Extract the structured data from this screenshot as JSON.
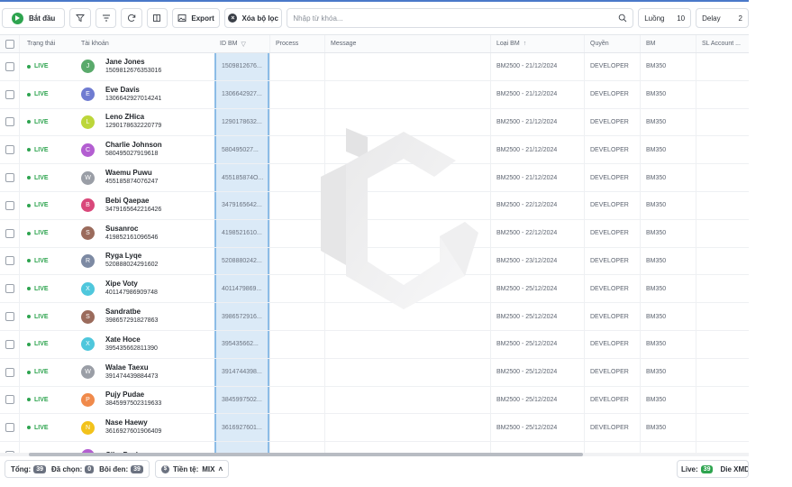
{
  "toolbar": {
    "start_label": "Bắt đầu",
    "export_label": "Export",
    "clear_filter_label": "Xóa bộ lọc",
    "search_placeholder": "Nhập từ khóa...",
    "threads_label": "Luồng",
    "threads_value": "10",
    "delay_label": "Delay",
    "delay_value": "2"
  },
  "columns": {
    "status": "Trạng thái",
    "account": "Tài khoản",
    "id_bm": "ID BM",
    "process": "Process",
    "message": "Message",
    "bm_type": "Loại BM",
    "role": "Quyền",
    "bm": "BM",
    "sl_account": "SL Account ..."
  },
  "rows": [
    {
      "status": "LIVE",
      "initial": "J",
      "color": "#5aaa6b",
      "name": "Jane Jones",
      "uid": "1509812676353016",
      "id_bm": "1509812676...",
      "bm_type": "BM2500 - 21/12/2024",
      "role": "DEVELOPER",
      "bm": "BM350"
    },
    {
      "status": "LIVE",
      "initial": "E",
      "color": "#6f7bd1",
      "name": "Eve Davis",
      "uid": "1306642927014241",
      "id_bm": "1306642927...",
      "bm_type": "BM2500 - 21/12/2024",
      "role": "DEVELOPER",
      "bm": "BM350"
    },
    {
      "status": "LIVE",
      "initial": "L",
      "color": "#bcd63a",
      "name": "Leno ZHica",
      "uid": "1290178632220779",
      "id_bm": "1290178632...",
      "bm_type": "BM2500 - 21/12/2024",
      "role": "DEVELOPER",
      "bm": "BM350"
    },
    {
      "status": "LIVE",
      "initial": "C",
      "color": "#b35ed1",
      "name": "Charlie Johnson",
      "uid": "580495027919618",
      "id_bm": "580495027...",
      "bm_type": "BM2500 - 21/12/2024",
      "role": "DEVELOPER",
      "bm": "BM350"
    },
    {
      "status": "LIVE",
      "initial": "W",
      "color": "#9a9ea6",
      "name": "Waemu Puwu",
      "uid": "455185874076247",
      "id_bm": "455185874O...",
      "bm_type": "BM2500 - 21/12/2024",
      "role": "DEVELOPER",
      "bm": "BM350"
    },
    {
      "status": "LIVE",
      "initial": "B",
      "color": "#d9487a",
      "name": "Bebi Qaepae",
      "uid": "3479165642216426",
      "id_bm": "3479165642...",
      "bm_type": "BM2500 - 22/12/2024",
      "role": "DEVELOPER",
      "bm": "BM350"
    },
    {
      "status": "LIVE",
      "initial": "S",
      "color": "#9b6b5c",
      "name": "Susanroc",
      "uid": "419852161096546",
      "id_bm": "4198521610...",
      "bm_type": "BM2500 - 22/12/2024",
      "role": "DEVELOPER",
      "bm": "BM350"
    },
    {
      "status": "LIVE",
      "initial": "R",
      "color": "#7d8aa3",
      "name": "Ryga Lyqe",
      "uid": "520888024291602",
      "id_bm": "5208880242...",
      "bm_type": "BM2500 - 23/12/2024",
      "role": "DEVELOPER",
      "bm": "BM350"
    },
    {
      "status": "LIVE",
      "initial": "X",
      "color": "#4fc7dc",
      "name": "Xipe Voty",
      "uid": "401147986909748",
      "id_bm": "4011479869...",
      "bm_type": "BM2500 - 25/12/2024",
      "role": "DEVELOPER",
      "bm": "BM350"
    },
    {
      "status": "LIVE",
      "initial": "S",
      "color": "#9b6b5c",
      "name": "Sandratbe",
      "uid": "398657291827863",
      "id_bm": "3986572916...",
      "bm_type": "BM2500 - 25/12/2024",
      "role": "DEVELOPER",
      "bm": "BM350"
    },
    {
      "status": "LIVE",
      "initial": "X",
      "color": "#4fc7dc",
      "name": "Xate Hoce",
      "uid": "395435662811390",
      "id_bm": "395435662...",
      "bm_type": "BM2500 - 25/12/2024",
      "role": "DEVELOPER",
      "bm": "BM350"
    },
    {
      "status": "LIVE",
      "initial": "W",
      "color": "#9a9ea6",
      "name": "Walae Taexu",
      "uid": "391474439884473",
      "id_bm": "3914744398...",
      "bm_type": "BM2500 - 25/12/2024",
      "role": "DEVELOPER",
      "bm": "BM350"
    },
    {
      "status": "LIVE",
      "initial": "P",
      "color": "#f08a4b",
      "name": "Pujy Pudae",
      "uid": "3845997502319633",
      "id_bm": "3845997502...",
      "bm_type": "BM2500 - 25/12/2024",
      "role": "DEVELOPER",
      "bm": "BM350"
    },
    {
      "status": "LIVE",
      "initial": "N",
      "color": "#f2c21b",
      "name": "Nase Haewy",
      "uid": "3616927601906409",
      "id_bm": "3616927601...",
      "bm_type": "BM2500 - 25/12/2024",
      "role": "DEVELOPER",
      "bm": "BM350"
    },
    {
      "status": "LIVE",
      "initial": "C",
      "color": "#b35ed1",
      "name": "Ciba Puzhae",
      "uid": "",
      "id_bm": "",
      "bm_type": "",
      "role": "",
      "bm": ""
    }
  ],
  "footer": {
    "total_label": "Tổng:",
    "total_value": "39",
    "selected_label": "Đã chọn:",
    "selected_value": "0",
    "highlighted_label": "Bôi đen:",
    "highlighted_value": "39",
    "currency_label": "Tiền tệ:",
    "currency_value": "MIX",
    "live_label": "Live:",
    "live_value": "39",
    "die_label": "Die XMD"
  }
}
